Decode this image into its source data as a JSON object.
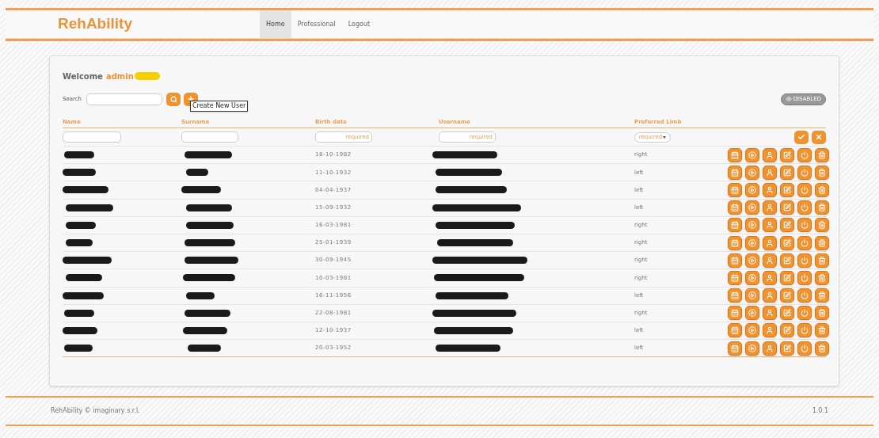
{
  "header": {
    "logo": "RehAbility",
    "nav": [
      {
        "label": "Home",
        "selected": true
      },
      {
        "label": "Professional",
        "selected": false
      },
      {
        "label": "Logout",
        "selected": false
      }
    ]
  },
  "welcome": {
    "text": "Welcome",
    "user": "admin"
  },
  "search": {
    "label": "Search"
  },
  "tooltip": "Create New User",
  "filter_toggle": {
    "label": "DISABLED"
  },
  "table": {
    "columns": [
      "Name",
      "Surname",
      "Birth date",
      "Username",
      "Preferred Limb"
    ],
    "new_row": {
      "birth_date_placeholder": "required",
      "username_placeholder": "required",
      "limb_placeholder": "required"
    },
    "rows": [
      {
        "birth_date": "18-10-1982",
        "limb": "right"
      },
      {
        "birth_date": "11-10-1932",
        "limb": "left"
      },
      {
        "birth_date": "04-04-1937",
        "limb": "left"
      },
      {
        "birth_date": "15-09-1932",
        "limb": "left"
      },
      {
        "birth_date": "16-03-1981",
        "limb": "right"
      },
      {
        "birth_date": "25-01-1939",
        "limb": "right"
      },
      {
        "birth_date": "30-09-1945",
        "limb": "right"
      },
      {
        "birth_date": "10-03-1981",
        "limb": "right"
      },
      {
        "birth_date": "16-11-1956",
        "limb": "left"
      },
      {
        "birth_date": "22-08-1981",
        "limb": "right"
      },
      {
        "birth_date": "12-10-1937",
        "limb": "left"
      },
      {
        "birth_date": "20-03-1952",
        "limb": "left"
      }
    ]
  },
  "footer": {
    "copyright": "RehAbility © imaginary s.r.l.",
    "version": "1.0.1"
  }
}
